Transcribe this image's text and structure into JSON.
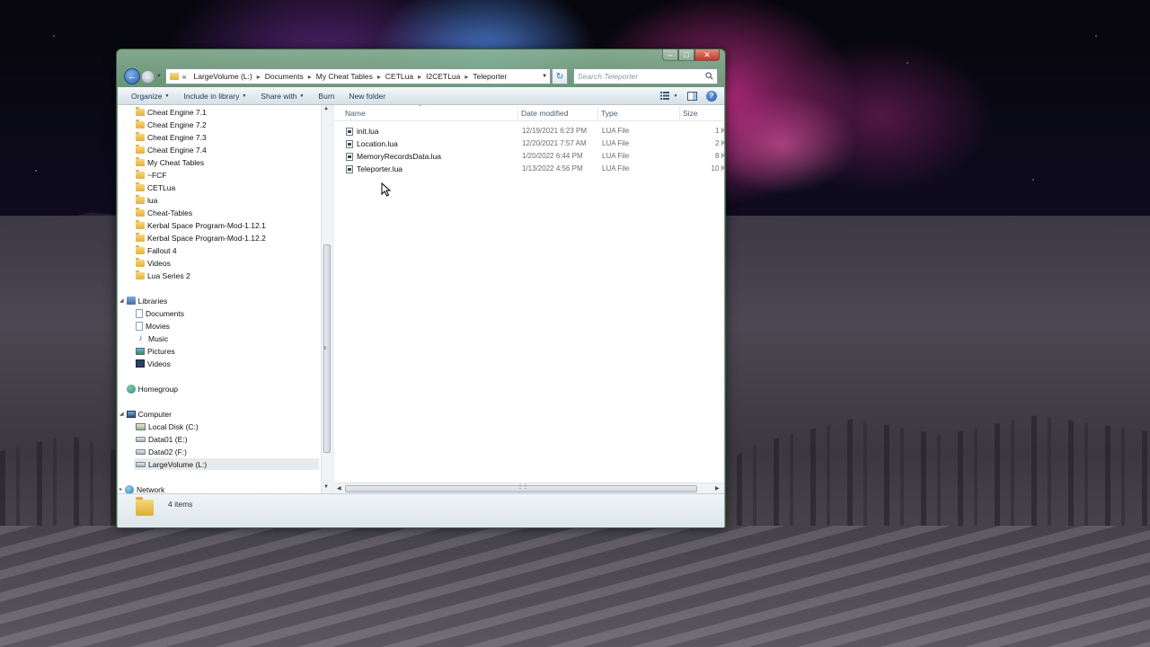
{
  "address": {
    "overflow": "«",
    "segments": [
      "LargeVolume (L:)",
      "Documents",
      "My Cheat Tables",
      "CETLua",
      "I2CETLua",
      "Teleporter"
    ]
  },
  "search": {
    "placeholder": "Search Teleporter"
  },
  "toolbar": {
    "organize": "Organize",
    "include_in_library": "Include in library",
    "share_with": "Share with",
    "burn": "Burn",
    "new_folder": "New folder"
  },
  "nav_tree": {
    "folders": [
      "Cheat Engine 7.1",
      "Cheat Engine 7.2",
      "Cheat Engine 7.3",
      "Cheat Engine 7.4",
      "My Cheat Tables",
      "~FCF",
      "CETLua",
      "lua",
      "Cheat-Tables",
      "Kerbal Space Program-Mod-1.12.1",
      "Kerbal Space Program-Mod-1.12.2",
      "Fallout 4",
      "Videos",
      "Lua Series 2"
    ],
    "libraries": {
      "label": "Libraries",
      "items": [
        "Documents",
        "Movies",
        "Music",
        "Pictures",
        "Videos"
      ]
    },
    "homegroup": "Homegroup",
    "computer": {
      "label": "Computer",
      "drives": [
        "Local Disk (C:)",
        "Data01 (E:)",
        "Data02 (F:)",
        "LargeVolume (L:)"
      ]
    },
    "network": "Network"
  },
  "columns": {
    "name": "Name",
    "date": "Date modified",
    "type": "Type",
    "size": "Size"
  },
  "files": [
    {
      "name": "init.lua",
      "date": "12/19/2021 6:23 PM",
      "type": "LUA File",
      "size": "1 K"
    },
    {
      "name": "Location.lua",
      "date": "12/20/2021 7:57 AM",
      "type": "LUA File",
      "size": "2 K"
    },
    {
      "name": "MemoryRecordsData.lua",
      "date": "1/20/2022 6:44 PM",
      "type": "LUA File",
      "size": "8 K"
    },
    {
      "name": "Teleporter.lua",
      "date": "1/13/2022 4:56 PM",
      "type": "LUA File",
      "size": "10 K"
    }
  ],
  "status": {
    "item_count": "4 items"
  },
  "colors": {
    "window_frame": "#6ea07d",
    "close_button": "#c0392b",
    "link_text": "#1e3a52"
  }
}
